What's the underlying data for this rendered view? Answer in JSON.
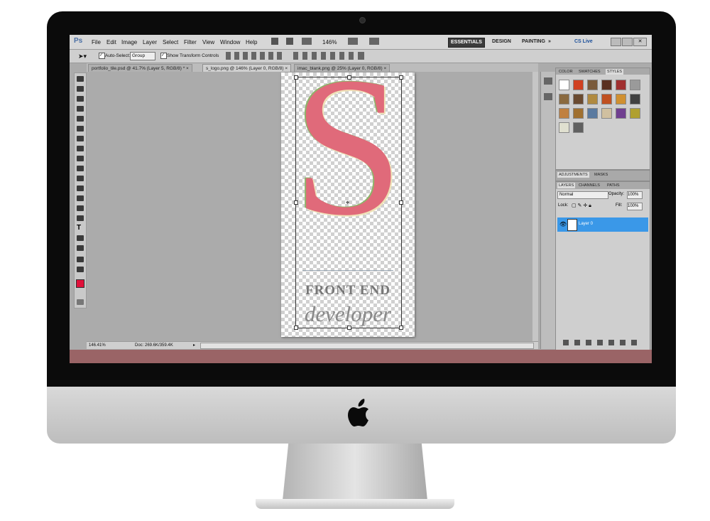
{
  "menubar": {
    "app_icon": "Ps",
    "items": [
      "File",
      "Edit",
      "Image",
      "Layer",
      "Select",
      "Filter",
      "View",
      "Window",
      "Help"
    ],
    "zoom": "146%",
    "workspaces": [
      "ESSENTIALS",
      "DESIGN",
      "PAINTING"
    ],
    "cs_live": "CS Live"
  },
  "options": {
    "auto_select_label": "Auto-Select:",
    "auto_select_value": "Group",
    "show_transform_label": "Show Transform Controls"
  },
  "tabs": [
    "portfolio_tile.psd @ 41.7% (Layer 5, RGB/8) *",
    "s_logo.png @ 146% (Layer 0, RGB/8)",
    "imac_blank.png @ 25% (Layer 0, RGB/8)"
  ],
  "document": {
    "letter": "S",
    "line1": "FRONT END",
    "line2": "developer"
  },
  "status": {
    "zoom": "146.41%",
    "doc": "Doc: 269.6K/359.4K"
  },
  "panels": {
    "top_tabs": [
      "COLOR",
      "SWATCHES",
      "STYLES"
    ],
    "mid_tabs": [
      "ADJUSTMENTS",
      "MASKS"
    ],
    "layer_tabs": [
      "LAYERS",
      "CHANNELS",
      "PATHS"
    ],
    "blend_mode": "Normal",
    "opacity_label": "Opacity:",
    "opacity_value": "100%",
    "lock_label": "Lock:",
    "fill_label": "Fill:",
    "fill_value": "100%",
    "layer_name": "Layer 0"
  },
  "colors": {
    "foreground": "#e0103a",
    "selection": "#3a98e8",
    "taskbar": "#9a6466"
  }
}
